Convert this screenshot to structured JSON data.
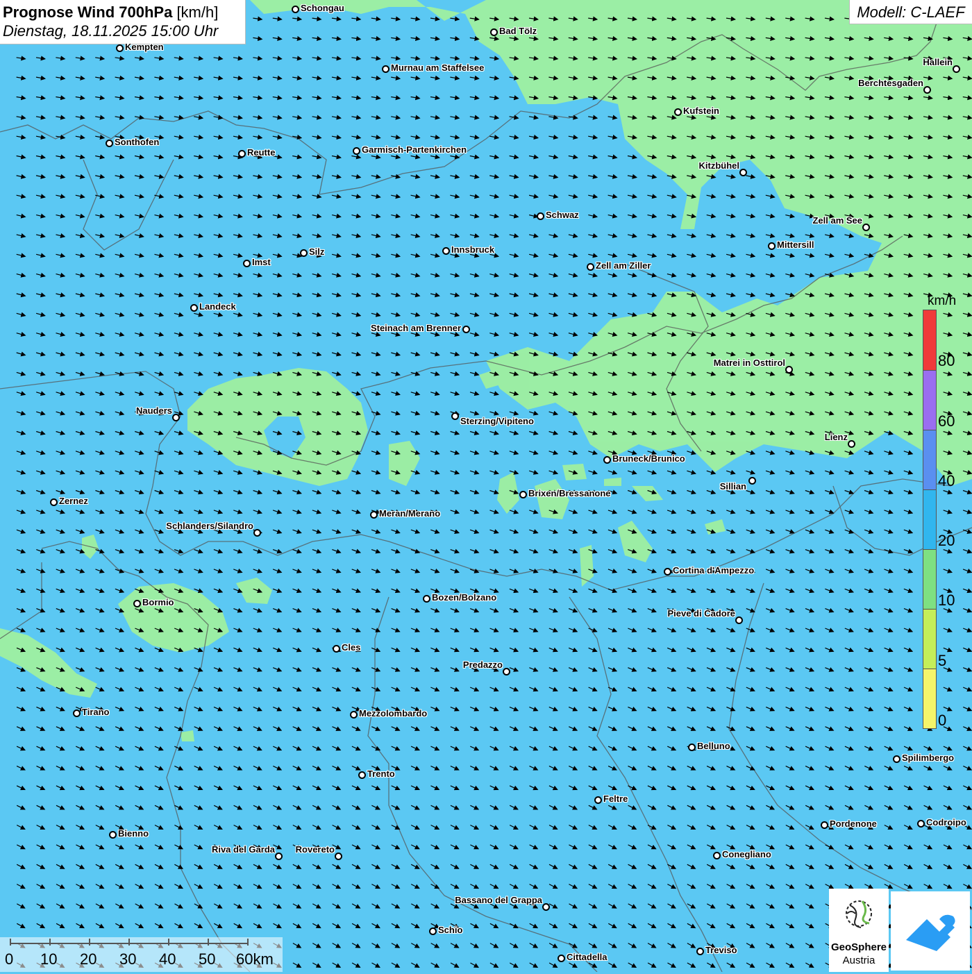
{
  "title": {
    "bold": "Prognose Wind 700hPa",
    "unit": "[km/h]",
    "date": "Dienstag, 18.11.2025 15:00 Uhr"
  },
  "model": "Modell: C-LAEF",
  "legend": {
    "unit": "km/h",
    "labels": [
      "80",
      "60",
      "40",
      "20",
      "10",
      "5",
      "0"
    ],
    "colors": [
      "#f03a3a",
      "#9a6ef0",
      "#5a8ff0",
      "#31b6ee",
      "#7ee082",
      "#c4ee5a",
      "#f5f56a"
    ]
  },
  "scale": {
    "labels": [
      "0",
      "10",
      "20",
      "30",
      "40",
      "50",
      "60km"
    ]
  },
  "logos": {
    "geosphere_line1": "GeoSphere",
    "geosphere_line2": "Austria"
  },
  "colors": {
    "water_speed": "#5bc8f3",
    "light_speed": "#9ff0a0"
  },
  "cities": [
    {
      "name": "Schongau"
    },
    {
      "name": "Kempten"
    },
    {
      "name": "Bad Tölz"
    },
    {
      "name": "Murnau am Staffelsee"
    },
    {
      "name": "Hallein"
    },
    {
      "name": "Berchtesgaden"
    },
    {
      "name": "Kufstein"
    },
    {
      "name": "Sonthofen"
    },
    {
      "name": "Reutte"
    },
    {
      "name": "Garmisch-Partenkirchen"
    },
    {
      "name": "Kitzbühel"
    },
    {
      "name": "Schwaz"
    },
    {
      "name": "Zell am See"
    },
    {
      "name": "Mittersill"
    },
    {
      "name": "Innsbruck"
    },
    {
      "name": "Silz"
    },
    {
      "name": "Imst"
    },
    {
      "name": "Zell am Ziller"
    },
    {
      "name": "Landeck"
    },
    {
      "name": "Steinach am Brenner"
    },
    {
      "name": "Matrei in Osttirol"
    },
    {
      "name": "Nauders"
    },
    {
      "name": "Sterzing/Vipiteno"
    },
    {
      "name": "Lienz"
    },
    {
      "name": "Bruneck/Brunico"
    },
    {
      "name": "Sillian"
    },
    {
      "name": "Brixen/Bressanone"
    },
    {
      "name": "Zernez"
    },
    {
      "name": "Meran/Merano"
    },
    {
      "name": "Schlanders/Silandro"
    },
    {
      "name": "Cortina d'Ampezzo"
    },
    {
      "name": "Bozen/Bolzano"
    },
    {
      "name": "Bormio"
    },
    {
      "name": "Pieve di Cadore"
    },
    {
      "name": "Cles"
    },
    {
      "name": "Predazzo"
    },
    {
      "name": "Tirano"
    },
    {
      "name": "Mezzolombardo"
    },
    {
      "name": "Belluno"
    },
    {
      "name": "Spilimbergo"
    },
    {
      "name": "Trento"
    },
    {
      "name": "Feltre"
    },
    {
      "name": "Pordenone"
    },
    {
      "name": "Codroipo"
    },
    {
      "name": "Bienno"
    },
    {
      "name": "Riva del Garda"
    },
    {
      "name": "Rovereto"
    },
    {
      "name": "Conegliano"
    },
    {
      "name": "Bassano del Grappa"
    },
    {
      "name": "Schio"
    },
    {
      "name": "Treviso"
    },
    {
      "name": "Cittadella"
    }
  ]
}
